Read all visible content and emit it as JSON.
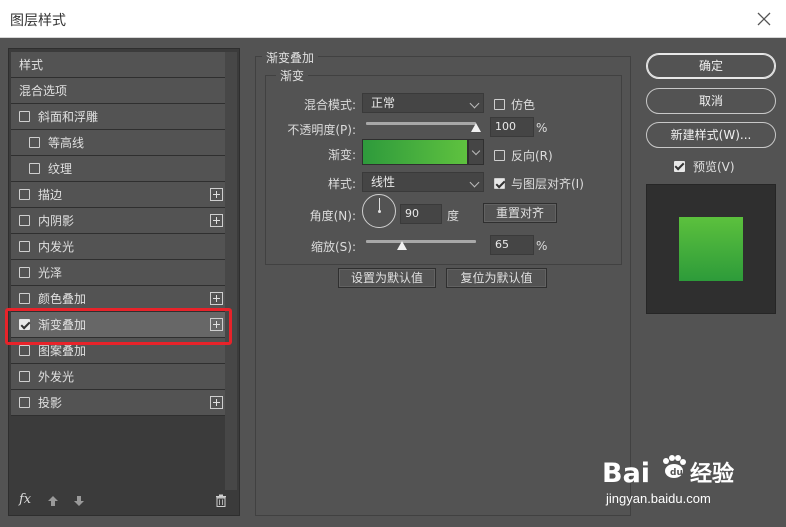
{
  "window": {
    "title": "图层样式"
  },
  "left": {
    "items": [
      {
        "label": "样式",
        "checkbox": false,
        "plus": false,
        "indent": false,
        "checked": false,
        "kind": "header"
      },
      {
        "label": "混合选项",
        "checkbox": false,
        "plus": false,
        "indent": false,
        "checked": false,
        "kind": "header"
      },
      {
        "label": "斜面和浮雕",
        "checkbox": true,
        "plus": false,
        "indent": false,
        "checked": false
      },
      {
        "label": "等高线",
        "checkbox": true,
        "plus": false,
        "indent": true,
        "checked": false
      },
      {
        "label": "纹理",
        "checkbox": true,
        "plus": false,
        "indent": true,
        "checked": false
      },
      {
        "label": "描边",
        "checkbox": true,
        "plus": true,
        "indent": false,
        "checked": false
      },
      {
        "label": "内阴影",
        "checkbox": true,
        "plus": true,
        "indent": false,
        "checked": false
      },
      {
        "label": "内发光",
        "checkbox": true,
        "plus": false,
        "indent": false,
        "checked": false
      },
      {
        "label": "光泽",
        "checkbox": true,
        "plus": false,
        "indent": false,
        "checked": false
      },
      {
        "label": "颜色叠加",
        "checkbox": true,
        "plus": true,
        "indent": false,
        "checked": false
      },
      {
        "label": "渐变叠加",
        "checkbox": true,
        "plus": true,
        "indent": false,
        "checked": true,
        "selected": true
      },
      {
        "label": "图案叠加",
        "checkbox": true,
        "plus": false,
        "indent": false,
        "checked": false
      },
      {
        "label": "外发光",
        "checkbox": true,
        "plus": false,
        "indent": false,
        "checked": false
      },
      {
        "label": "投影",
        "checkbox": true,
        "plus": true,
        "indent": false,
        "checked": false
      }
    ],
    "footer_fx": "fx"
  },
  "gradient_overlay": {
    "group_title": "渐变叠加",
    "sub_title": "渐变",
    "blend_mode_label": "混合模式:",
    "blend_mode_value": "正常",
    "dither_label": "仿色",
    "opacity_label": "不透明度(P):",
    "opacity_value": "100",
    "opacity_unit": "%",
    "opacity_fraction": 1.0,
    "gradient_label": "渐变:",
    "reverse_label": "反向(R)",
    "style_label": "样式:",
    "style_value": "线性",
    "align_label": "与图层对齐(I)",
    "angle_label": "角度(N):",
    "angle_value": "90",
    "angle_unit": "度",
    "reset_align_label": "重置对齐",
    "scale_label": "缩放(S):",
    "scale_value": "65",
    "scale_unit": "%",
    "scale_fraction": 0.33,
    "set_default_label": "设置为默认值",
    "reset_default_label": "复位为默认值"
  },
  "right": {
    "ok_label": "确定",
    "cancel_label": "取消",
    "new_style_label": "新建样式(W)...",
    "preview_label": "预览(V)"
  },
  "colors": {
    "gradient_start": "#2e9a3c",
    "gradient_end": "#5fc23f",
    "highlight": "#e8232a"
  },
  "watermark": {
    "brand_a": "Bai",
    "brand_b": "经验",
    "url": "jingyan.baidu.com"
  }
}
